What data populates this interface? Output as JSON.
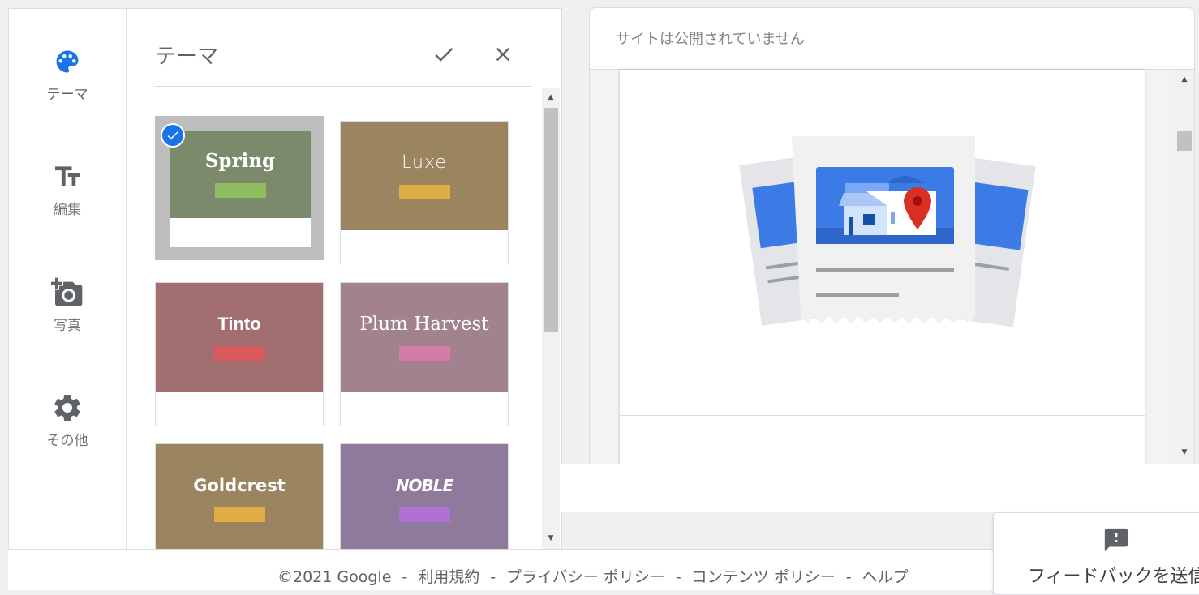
{
  "nav": {
    "items": [
      {
        "label": "テーマ",
        "icon": "palette-icon",
        "active": true
      },
      {
        "label": "編集",
        "icon": "text-format-icon"
      },
      {
        "label": "写真",
        "icon": "add-photo-icon"
      },
      {
        "label": "その他",
        "icon": "gear-icon"
      }
    ]
  },
  "panel": {
    "title": "テーマ",
    "confirm_icon": "check-icon",
    "close_icon": "close-icon"
  },
  "themes": [
    {
      "name": "Spring",
      "bg": "#7b8a6b",
      "bar": "#8fbc5f",
      "selected": true
    },
    {
      "name": "Luxe",
      "bg": "#9b8560",
      "bar": "#e0ac43"
    },
    {
      "name": "Tinto",
      "bg": "#a26f70",
      "bar": "#d95b5b"
    },
    {
      "name": "Plum Harvest",
      "bg": "#a38290",
      "bar": "#d47ba6"
    },
    {
      "name": "Goldcrest",
      "bg": "#9a8560",
      "bar": "#e0ac43"
    },
    {
      "name": "NOBLE",
      "bg": "#8f7a9c",
      "bar": "#b170d4"
    }
  ],
  "preview": {
    "status": "サイトは公開されていません"
  },
  "footer": {
    "copyright": "©2021 Google",
    "links": [
      "利用規約",
      "プライバシー ポリシー",
      "コンテンツ ポリシー",
      "ヘルプ"
    ],
    "separator": "-"
  },
  "feedback": {
    "label": "フィードバックを送信",
    "icon": "feedback-icon"
  },
  "colors": {
    "accent": "#1a73e8",
    "map_pin": "#d93025"
  }
}
